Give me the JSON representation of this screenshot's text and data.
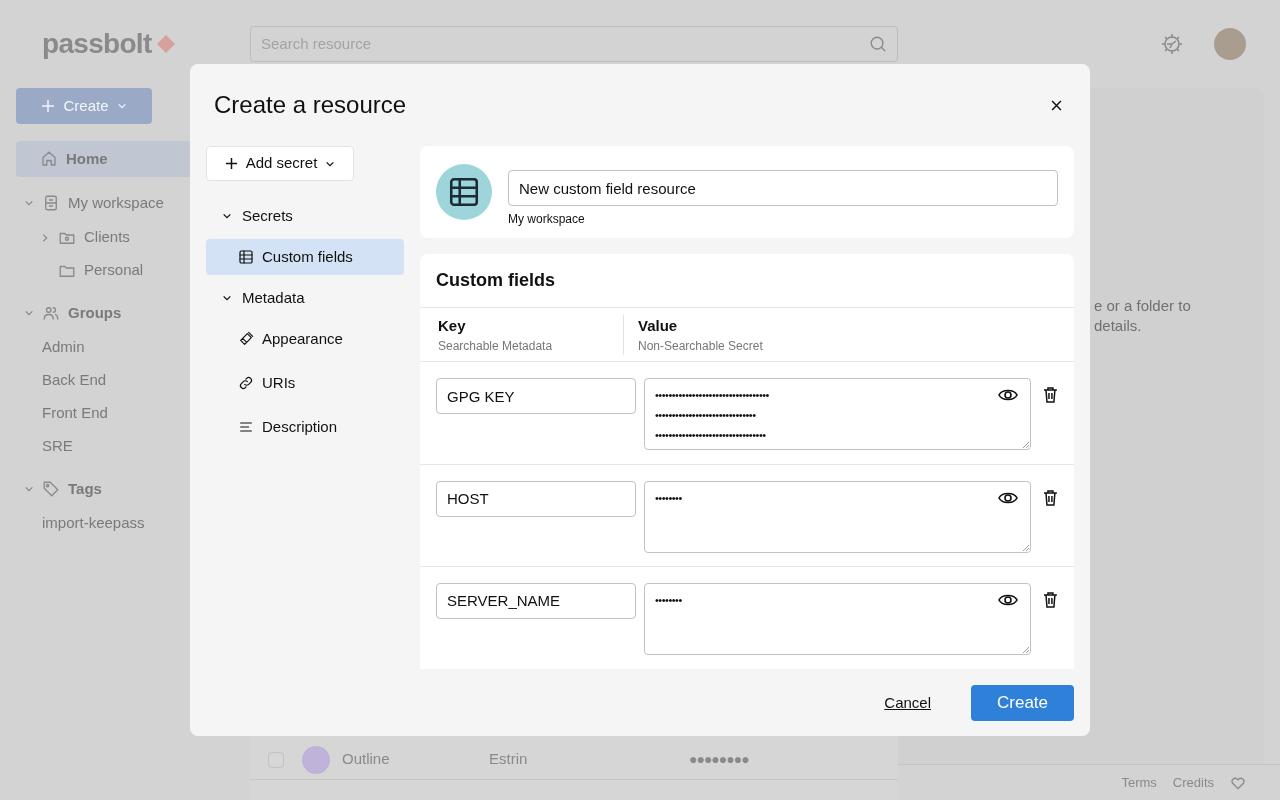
{
  "app": {
    "logo": "passbolt",
    "search_placeholder": "Search resource",
    "create_button": "Create",
    "sidebar": [
      {
        "label": "Home",
        "kind": "home",
        "selected": true
      },
      {
        "label": "My workspace",
        "kind": "workspace",
        "selected": false,
        "children": [
          {
            "label": "Clients",
            "kind": "shared-folder"
          },
          {
            "label": "Personal",
            "kind": "folder"
          }
        ]
      },
      {
        "label": "Groups",
        "kind": "groups",
        "selected": false,
        "children": [
          {
            "label": "Admin",
            "kind": "plain"
          },
          {
            "label": "Back End",
            "kind": "plain"
          },
          {
            "label": "Front End",
            "kind": "plain"
          },
          {
            "label": "SRE",
            "kind": "plain"
          }
        ]
      },
      {
        "label": "Tags",
        "kind": "tags",
        "selected": false,
        "children": [
          {
            "label": "import-keepass",
            "kind": "plain"
          }
        ]
      }
    ],
    "rows": [
      {
        "name": "Outline",
        "username": "Estrin",
        "password": "●●●●●●●●",
        "color": "#bfb3d9",
        "checked": false
      }
    ],
    "details_hint": [
      "e or a folder to",
      "details."
    ],
    "footer_links": [
      "Terms",
      "Credits"
    ]
  },
  "dialog": {
    "title": "Create a resource",
    "add_secret": "Add secret",
    "nav": [
      {
        "label": "Secrets",
        "expanded": true,
        "children": [
          {
            "label": "Custom fields",
            "kind": "table",
            "selected": true
          }
        ]
      },
      {
        "label": "Metadata",
        "expanded": true,
        "children": [
          {
            "label": "Appearance",
            "kind": "brush",
            "selected": false
          },
          {
            "label": "URIs",
            "kind": "link",
            "selected": false
          },
          {
            "label": "Description",
            "kind": "lines",
            "selected": false
          }
        ]
      }
    ],
    "name": "New custom field resource",
    "location": "My workspace",
    "section_title": "Custom fields",
    "columns": [
      {
        "label": "Key",
        "sublabel": "Searchable Metadata"
      },
      {
        "label": "Value",
        "sublabel": "Non-Searchable Secret"
      }
    ],
    "fields": [
      {
        "key": "GPG KEY",
        "value_lines": [
          "••••••••••••••••••••••••••••••••••",
          "••••••••••••••••••••••••••••••",
          "•••••••••••••••••••••••••••••••••"
        ]
      },
      {
        "key": "HOST",
        "value_lines": [
          "••••••••"
        ]
      },
      {
        "key": "SERVER_NAME",
        "value_lines": [
          "••••••••"
        ]
      }
    ],
    "cancel": "Cancel",
    "create": "Create"
  }
}
